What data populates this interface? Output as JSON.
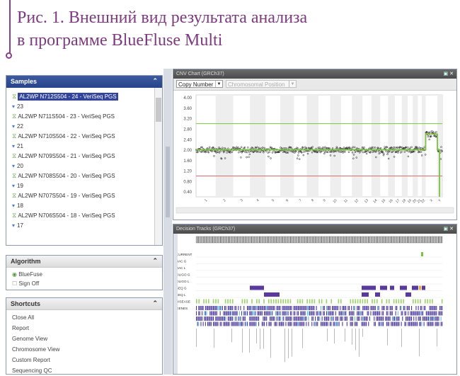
{
  "caption": {
    "line1": "Рис. 1. Внешний вид результата анализа",
    "line2": "в программе BlueFluse Multi"
  },
  "samples": {
    "title": "Samples",
    "rows": [
      {
        "type": "sample",
        "label": "AL2WP N712S504 - 24 - VeriSeq PGS",
        "selected": true
      },
      {
        "type": "group",
        "label": "23"
      },
      {
        "type": "sample",
        "label": "AL2WP N711S504 - 23 - VeriSeq PGS"
      },
      {
        "type": "group",
        "label": "22"
      },
      {
        "type": "sample",
        "label": "AL2WP N710S504 - 22 - VeriSeq PGS"
      },
      {
        "type": "group",
        "label": "21"
      },
      {
        "type": "sample",
        "label": "AL2WP N709S504 - 21 - VeriSeq PGS"
      },
      {
        "type": "group",
        "label": "20"
      },
      {
        "type": "sample",
        "label": "AL2WP N708S504 - 20 - VeriSeq PGS"
      },
      {
        "type": "group",
        "label": "19"
      },
      {
        "type": "sample",
        "label": "AL2WP N707S504 - 19 - VeriSeq PGS"
      },
      {
        "type": "group",
        "label": "18"
      },
      {
        "type": "sample",
        "label": "AL2WP N706S504 - 18 - VeriSeq PGS"
      },
      {
        "type": "group",
        "label": "17"
      }
    ]
  },
  "algorithm": {
    "title": "Algorithm",
    "options": [
      {
        "label": "BlueFuse",
        "checked": true
      },
      {
        "label": "Sign Off",
        "checked": false
      }
    ]
  },
  "shortcuts": {
    "title": "Shortcuts",
    "items": [
      "Close All",
      "Report",
      "Genome View",
      "Chromosome View",
      "Custom Report",
      "Sequencing QC"
    ]
  },
  "cnv": {
    "title": "CNV Chart (GRCh37)",
    "view_select": "Copy Number",
    "position_select": "Chromosomal Position",
    "chart_data": {
      "type": "scatter",
      "y_ticks": [
        "4.00",
        "3.60",
        "3.20",
        "2.80",
        "2.40",
        "2.00",
        "1.60",
        "1.20",
        "0.80",
        "0.40"
      ],
      "ylim": [
        0.2,
        4.1
      ],
      "x_ticks": [
        "1",
        "2",
        "3",
        "4",
        "5",
        "6",
        "7",
        "8",
        "9",
        "10",
        "11",
        "12",
        "13",
        "14",
        "15",
        "16",
        "17",
        "18",
        "19",
        "20",
        "21",
        "22",
        "X",
        "Y"
      ],
      "gain_threshold": 3.0,
      "loss_threshold": 1.0,
      "baseline": 2.0,
      "segments": [
        {
          "from_chrom": "1",
          "to_chrom": "22",
          "copy_number": 2.0
        },
        {
          "chrom": "X",
          "copy_number": 2.6
        },
        {
          "chrom": "Y",
          "copy_number": 2.0
        }
      ],
      "colors": {
        "points": "#222222",
        "segment": "#7dc242",
        "gain_line": "#7dc242",
        "loss_line": "#e06b6b"
      }
    }
  },
  "tracks": {
    "title": "Decision Tracks (GRCh37)",
    "rows": [
      "CURRENT",
      "BAC G",
      "BAC L",
      "OLIGO G",
      "OLIGO L",
      "SEQ G",
      "SEQ L",
      "DISEASE",
      "GENES"
    ],
    "colors": {
      "seq": "#5a3a9e",
      "disease": "#9bd165",
      "genes": "#4b3a9a",
      "current": "#7dc242"
    }
  }
}
